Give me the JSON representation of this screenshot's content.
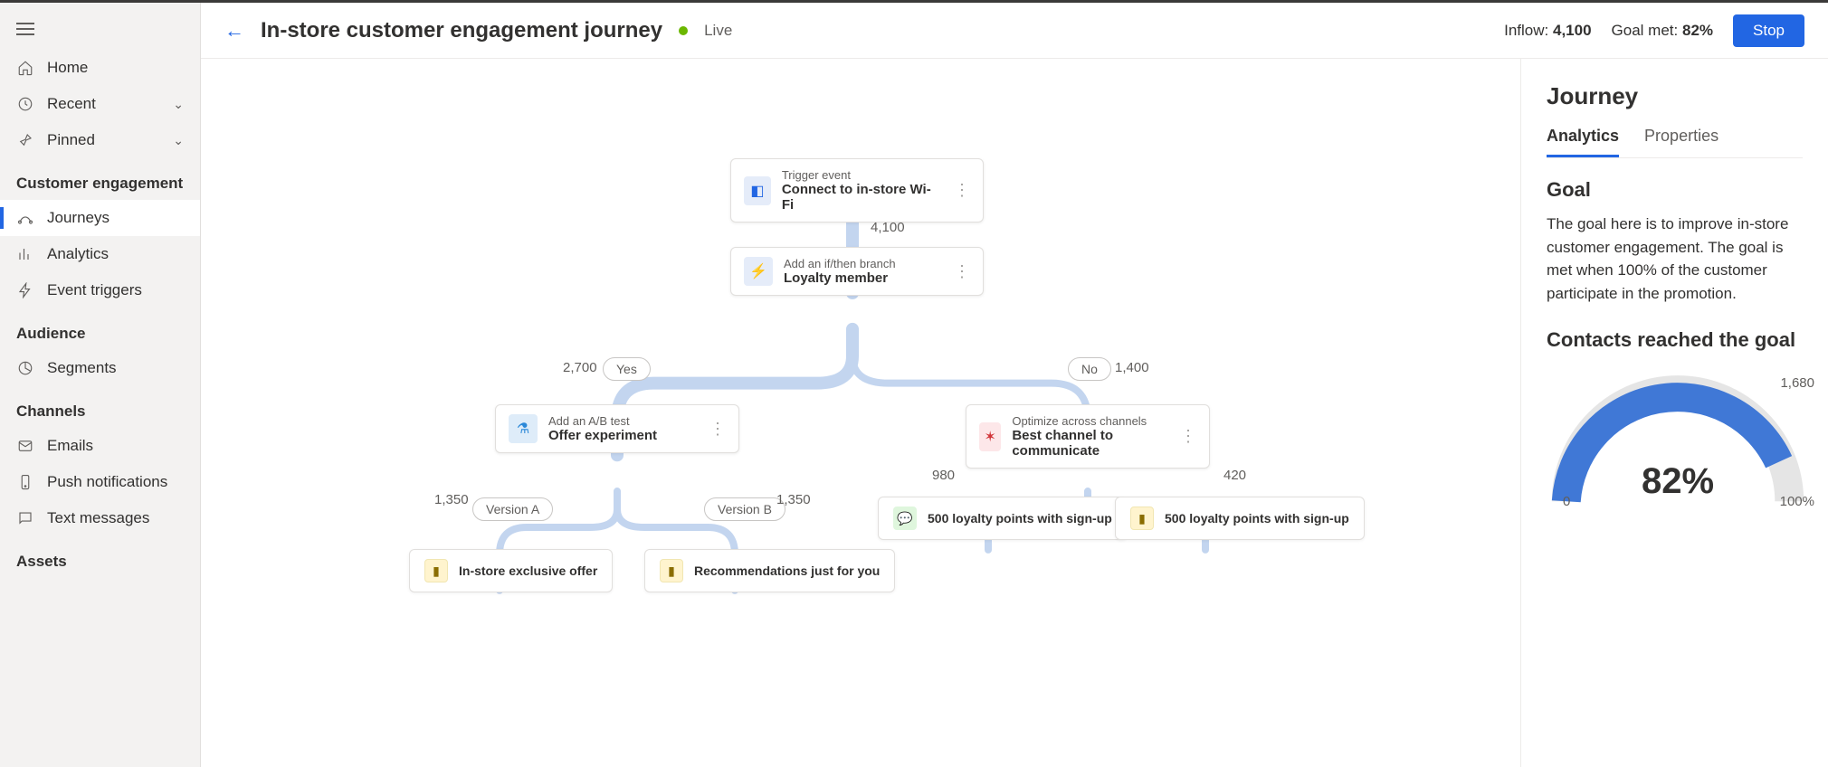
{
  "sidebar": {
    "home": "Home",
    "recent": "Recent",
    "pinned": "Pinned",
    "sections": {
      "customer_engagement": "Customer engagement",
      "audience": "Audience",
      "channels": "Channels",
      "assets": "Assets"
    },
    "items": {
      "journeys": "Journeys",
      "analytics": "Analytics",
      "event_triggers": "Event triggers",
      "segments": "Segments",
      "emails": "Emails",
      "push_notifications": "Push notifications",
      "text_messages": "Text messages"
    }
  },
  "header": {
    "title": "In-store customer engagement journey",
    "status": "Live",
    "inflow_label": "Inflow:",
    "inflow_value": "4,100",
    "goal_label": "Goal met:",
    "goal_value": "82%",
    "stop": "Stop"
  },
  "canvas": {
    "trigger": {
      "sub": "Trigger event",
      "title": "Connect to in-store Wi-Fi"
    },
    "trigger_count": "4,100",
    "branch": {
      "sub": "Add an if/then branch",
      "title": "Loyalty member"
    },
    "yes_count": "2,700",
    "yes_label": "Yes",
    "no_count": "1,400",
    "no_label": "No",
    "ab": {
      "sub": "Add an A/B test",
      "title": "Offer experiment"
    },
    "opt": {
      "sub": "Optimize across channels",
      "title": "Best channel to communicate"
    },
    "va_count": "1,350",
    "va_label": "Version A",
    "vb_count": "1,350",
    "vb_label": "Version B",
    "opt_left_count": "980",
    "opt_right_count": "420",
    "leaf_a": "In-store exclusive offer",
    "leaf_b": "Recommendations just for you",
    "leaf_c": "500 loyalty points with sign-up",
    "leaf_d": "500 loyalty points with sign-up"
  },
  "panel": {
    "heading": "Journey",
    "tab_analytics": "Analytics",
    "tab_properties": "Properties",
    "goal_heading": "Goal",
    "goal_text": "The goal here is to improve in-store customer engagement. The goal is met when 100% of the customer participate in the promotion.",
    "chart_heading": "Contacts reached the goal"
  },
  "chart_data": {
    "type": "pie",
    "title": "Contacts reached the goal",
    "value_pct": 82,
    "value_label": "82%",
    "reached_count": "1,680",
    "min_label": "0",
    "max_label": "100%",
    "range": [
      0,
      100
    ]
  }
}
